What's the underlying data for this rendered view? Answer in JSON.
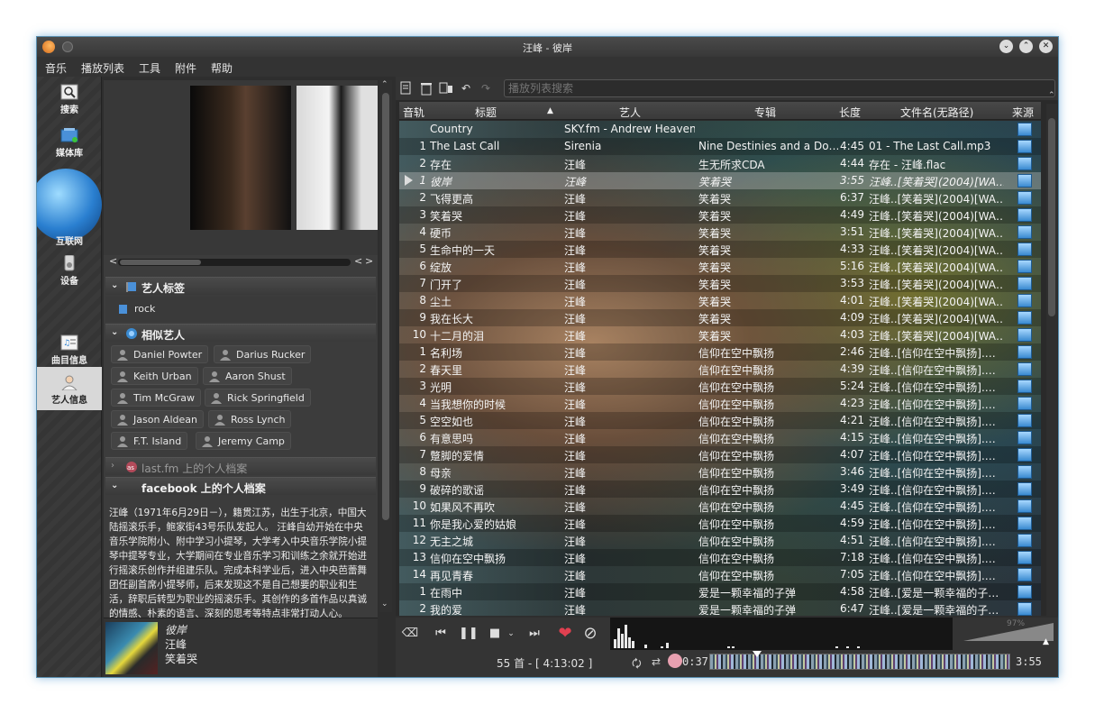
{
  "window": {
    "title": "汪峰 - 彼岸"
  },
  "menu": [
    "音乐",
    "播放列表",
    "工具",
    "附件",
    "帮助"
  ],
  "sidebar": {
    "items": [
      {
        "label": "搜索",
        "icon": "search-icon"
      },
      {
        "label": "媒体库",
        "icon": "library-icon"
      },
      {
        "label": "互联网",
        "icon": "globe-icon"
      },
      {
        "label": "设备",
        "icon": "device-icon"
      },
      {
        "label": "曲目信息",
        "icon": "track-info-icon"
      },
      {
        "label": "艺人信息",
        "icon": "artist-info-icon"
      }
    ]
  },
  "context": {
    "tags_header": "艺人标签",
    "tag": "rock",
    "similar_header": "相似艺人",
    "similar_artists": [
      "Daniel Powter",
      "Darius Rucker",
      "Keith Urban",
      "Aaron Shust",
      "Tim McGraw",
      "Rick Springfield",
      "Jason Aldean",
      "Ross Lynch",
      "F.T. Island",
      "Jeremy Camp"
    ],
    "lastfm_header": "last.fm 上的个人档案",
    "facebook_header": "facebook 上的个人档案",
    "bio": "汪峰（1971年6月29日－），籍贯江苏，出生于北京，中国大陆摇滚乐手，鲍家街43号乐队发起人。 汪峰自幼开始在中央音乐学院附小、附中学习小提琴，大学考入中央音乐学院小提琴中提琴专业，大学期间在专业音乐学习和训练之余就开始进行摇滚乐创作并组建乐队。完成本科学业后，进入中央芭蕾舞团任副首席小提琴师，后来发现这不是自己想要的职业和生活，辞职后转型为职业的摇滚乐手。其创作的多首作品以真诚的情感、朴素的语言、深刻的思考等特点非常打动人心。"
  },
  "now_playing": {
    "title": "彼岸",
    "artist": "汪峰",
    "album": "笑着哭"
  },
  "playlist": {
    "search_placeholder": "播放列表搜索",
    "columns": [
      "音轨",
      "标题",
      "艺人",
      "专辑",
      "长度",
      "文件名(无路径)",
      "来源"
    ],
    "rows": [
      {
        "track": "",
        "title": "Country",
        "artist": "SKY.fm - Andrew Heavener",
        "album": "",
        "length": "",
        "file": ""
      },
      {
        "track": "1",
        "title": "The Last Call",
        "artist": "Sirenia",
        "album": "Nine Destinies and a Do…",
        "length": "4:45",
        "file": "01 - The Last Call.mp3"
      },
      {
        "track": "2",
        "title": "存在",
        "artist": "汪峰",
        "album": "生无所求CDA",
        "length": "4:44",
        "file": "存在 - 汪峰.flac"
      },
      {
        "track": "1",
        "title": "彼岸",
        "artist": "汪峰",
        "album": "笑着哭",
        "length": "3:55",
        "file": "汪峰..[笑着哭](2004)[WA…"
      },
      {
        "track": "2",
        "title": "飞得更高",
        "artist": "汪峰",
        "album": "笑着哭",
        "length": "6:37",
        "file": "汪峰..[笑着哭](2004)[WA…"
      },
      {
        "track": "3",
        "title": "笑着哭",
        "artist": "汪峰",
        "album": "笑着哭",
        "length": "4:49",
        "file": "汪峰..[笑着哭](2004)[WA…"
      },
      {
        "track": "4",
        "title": "硬币",
        "artist": "汪峰",
        "album": "笑着哭",
        "length": "3:51",
        "file": "汪峰..[笑着哭](2004)[WA…"
      },
      {
        "track": "5",
        "title": "生命中的一天",
        "artist": "汪峰",
        "album": "笑着哭",
        "length": "4:33",
        "file": "汪峰..[笑着哭](2004)[WA…"
      },
      {
        "track": "6",
        "title": "绽放",
        "artist": "汪峰",
        "album": "笑着哭",
        "length": "5:16",
        "file": "汪峰..[笑着哭](2004)[WA…"
      },
      {
        "track": "7",
        "title": "门开了",
        "artist": "汪峰",
        "album": "笑着哭",
        "length": "3:53",
        "file": "汪峰..[笑着哭](2004)[WA…"
      },
      {
        "track": "8",
        "title": "尘土",
        "artist": "汪峰",
        "album": "笑着哭",
        "length": "4:01",
        "file": "汪峰..[笑着哭](2004)[WA…"
      },
      {
        "track": "9",
        "title": "我在长大",
        "artist": "汪峰",
        "album": "笑着哭",
        "length": "4:09",
        "file": "汪峰..[笑着哭](2004)[WA…"
      },
      {
        "track": "10",
        "title": "十二月的泪",
        "artist": "汪峰",
        "album": "笑着哭",
        "length": "4:03",
        "file": "汪峰..[笑着哭](2004)[WA…"
      },
      {
        "track": "1",
        "title": "名利场",
        "artist": "汪峰",
        "album": "信仰在空中飘扬",
        "length": "2:46",
        "file": "汪峰..[信仰在空中飘扬].…"
      },
      {
        "track": "2",
        "title": "春天里",
        "artist": "汪峰",
        "album": "信仰在空中飘扬",
        "length": "4:39",
        "file": "汪峰..[信仰在空中飘扬].…"
      },
      {
        "track": "3",
        "title": "光明",
        "artist": "汪峰",
        "album": "信仰在空中飘扬",
        "length": "5:24",
        "file": "汪峰..[信仰在空中飘扬].…"
      },
      {
        "track": "4",
        "title": "当我想你的时候",
        "artist": "汪峰",
        "album": "信仰在空中飘扬",
        "length": "4:23",
        "file": "汪峰..[信仰在空中飘扬].…"
      },
      {
        "track": "5",
        "title": "空空如也",
        "artist": "汪峰",
        "album": "信仰在空中飘扬",
        "length": "4:21",
        "file": "汪峰..[信仰在空中飘扬].…"
      },
      {
        "track": "6",
        "title": "有意思吗",
        "artist": "汪峰",
        "album": "信仰在空中飘扬",
        "length": "4:15",
        "file": "汪峰..[信仰在空中飘扬].…"
      },
      {
        "track": "7",
        "title": "蹩脚的爱情",
        "artist": "汪峰",
        "album": "信仰在空中飘扬",
        "length": "4:07",
        "file": "汪峰..[信仰在空中飘扬].…"
      },
      {
        "track": "8",
        "title": "母亲",
        "artist": "汪峰",
        "album": "信仰在空中飘扬",
        "length": "3:46",
        "file": "汪峰..[信仰在空中飘扬].…"
      },
      {
        "track": "9",
        "title": "破碎的歌谣",
        "artist": "汪峰",
        "album": "信仰在空中飘扬",
        "length": "3:49",
        "file": "汪峰..[信仰在空中飘扬].…"
      },
      {
        "track": "10",
        "title": "如果风不再吹",
        "artist": "汪峰",
        "album": "信仰在空中飘扬",
        "length": "4:45",
        "file": "汪峰..[信仰在空中飘扬].…"
      },
      {
        "track": "11",
        "title": "你是我心爱的姑娘",
        "artist": "汪峰",
        "album": "信仰在空中飘扬",
        "length": "4:59",
        "file": "汪峰..[信仰在空中飘扬].…"
      },
      {
        "track": "12",
        "title": "无主之城",
        "artist": "汪峰",
        "album": "信仰在空中飘扬",
        "length": "4:51",
        "file": "汪峰..[信仰在空中飘扬].…"
      },
      {
        "track": "13",
        "title": "信仰在空中飘扬",
        "artist": "汪峰",
        "album": "信仰在空中飘扬",
        "length": "7:18",
        "file": "汪峰..[信仰在空中飘扬].…"
      },
      {
        "track": "14",
        "title": "再见青春",
        "artist": "汪峰",
        "album": "信仰在空中飘扬",
        "length": "7:05",
        "file": "汪峰..[信仰在空中飘扬].…"
      },
      {
        "track": "1",
        "title": "在雨中",
        "artist": "汪峰",
        "album": "爱是一颗幸福的子弹",
        "length": "4:58",
        "file": "汪峰..[爱是一颗幸福的子…"
      },
      {
        "track": "2",
        "title": "我的爱",
        "artist": "汪峰",
        "album": "爱是一颗幸福的子弹",
        "length": "6:47",
        "file": "汪峰..[爱是一颗幸福的子…"
      }
    ],
    "current_row": 3
  },
  "status": {
    "summary": "55 首 - [ 4:13:02 ]",
    "elapsed": "0:37",
    "total": "3:55",
    "progress_fraction": 0.157,
    "volume_label": "97%"
  }
}
